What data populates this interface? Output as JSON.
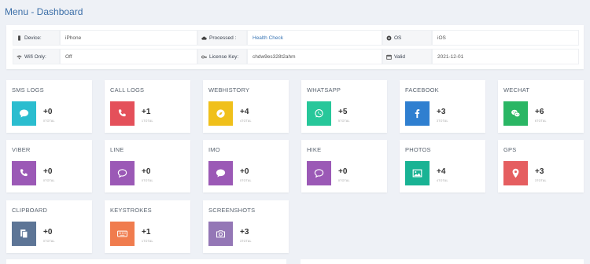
{
  "breadcrumb": "Menu - Dashboard",
  "info": {
    "device_label": "Device:",
    "device_value": "iPhone",
    "processed_label": "Processed :",
    "processed_value": "Health Check",
    "os_label": "OS",
    "os_value": "iOS",
    "wifi_label": "Wifi Only:",
    "wifi_value": "Off",
    "license_label": "License Key:",
    "license_value": "chdw9es328t2ahm",
    "valid_label": "Valid",
    "valid_value": "2021-12-01"
  },
  "tiles": [
    {
      "title": "SMS LOGS",
      "count": "+0",
      "sub": "0TOTAL",
      "color": "#2bbdcf",
      "icon": "chat-icon"
    },
    {
      "title": "CALL LOGS",
      "count": "+1",
      "sub": "1TOTAL",
      "color": "#e4505a",
      "icon": "phone-icon"
    },
    {
      "title": "WEBHISTORY",
      "count": "+4",
      "sub": "4TOTAL",
      "color": "#f0c01a",
      "icon": "compass-icon"
    },
    {
      "title": "WHATSAPP",
      "count": "+5",
      "sub": "5TOTAL",
      "color": "#27c79a",
      "icon": "whatsapp-icon"
    },
    {
      "title": "FACEBOOK",
      "count": "+3",
      "sub": "3TOTAL",
      "color": "#2f7fd0",
      "icon": "facebook-icon"
    },
    {
      "title": "WECHAT",
      "count": "+6",
      "sub": "6TOTAL",
      "color": "#2ab664",
      "icon": "wechat-icon"
    },
    {
      "title": "VIBER",
      "count": "+0",
      "sub": "0TOTAL",
      "color": "#9b59b6",
      "icon": "phone-icon"
    },
    {
      "title": "LINE",
      "count": "+0",
      "sub": "0TOTAL",
      "color": "#9b59b6",
      "icon": "chat-outline-icon"
    },
    {
      "title": "IMO",
      "count": "+0",
      "sub": "0TOTAL",
      "color": "#9b59b6",
      "icon": "chat-icon"
    },
    {
      "title": "HIKE",
      "count": "+0",
      "sub": "0TOTAL",
      "color": "#9b59b6",
      "icon": "chat-outline-icon"
    },
    {
      "title": "PHOTOS",
      "count": "+4",
      "sub": "4TOTAL",
      "color": "#19b394",
      "icon": "image-icon"
    },
    {
      "title": "GPS",
      "count": "+3",
      "sub": "3TOTAL",
      "color": "#e55e60",
      "icon": "map-pin-icon"
    },
    {
      "title": "CLIPBOARD",
      "count": "+0",
      "sub": "0TOTAL",
      "color": "#5d7596",
      "icon": "clipboard-icon"
    },
    {
      "title": "KEYSTROKES",
      "count": "+1",
      "sub": "1TOTAL",
      "color": "#f07c4e",
      "icon": "keyboard-icon"
    },
    {
      "title": "SCREENSHOTS",
      "count": "+3",
      "sub": "3TOTAL",
      "color": "#9477b6",
      "icon": "camera-icon"
    }
  ]
}
